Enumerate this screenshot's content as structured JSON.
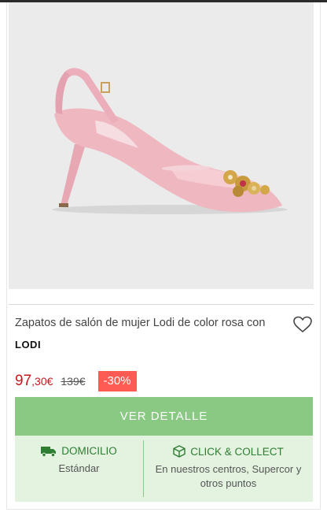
{
  "product": {
    "title": "Zapatos de salón de mujer Lodi de color rosa con",
    "brand": "LODI",
    "image_alt": "pink slingback pump with jeweled brooch",
    "favorite_icon": "heart-icon"
  },
  "price": {
    "current_integer": "97",
    "current_decimal": ",30€",
    "original": "139€",
    "discount": "-30%"
  },
  "cta": {
    "label": "VER DETALLE"
  },
  "delivery": {
    "home": {
      "icon": "truck-icon",
      "label": "DOMICILIO",
      "detail": "Estándar"
    },
    "collect": {
      "icon": "box-icon",
      "label": "CLICK & COLLECT",
      "detail": "En nuestros centros, Supercor y otros puntos"
    }
  },
  "colors": {
    "price_red": "#c9161d",
    "discount_bg": "#ff5b55",
    "cta_green": "#89c983",
    "delivery_bg": "#e3f3e0",
    "delivery_text": "#2e7d32"
  }
}
